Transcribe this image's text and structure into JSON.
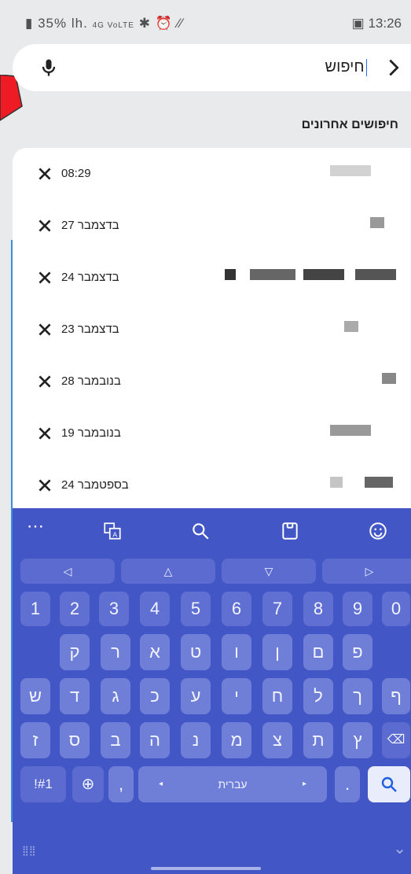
{
  "status": {
    "battery": "35%",
    "signal": "lh.",
    "network": "4G VoLTE",
    "time": "13:26"
  },
  "search": {
    "query": "חיפוש"
  },
  "recent": {
    "title": "חיפושים אחרונים",
    "items": [
      {
        "date": "08:29"
      },
      {
        "date": "27 בדצמבר"
      },
      {
        "date": "24 בדצמבר"
      },
      {
        "date": "23 בדצמבר"
      },
      {
        "date": "28 בנובמבר"
      },
      {
        "date": "19 בנובמבר"
      },
      {
        "date": "24 בספטמבר"
      }
    ]
  },
  "keyboard": {
    "number_row": [
      "1",
      "2",
      "3",
      "4",
      "5",
      "6",
      "7",
      "8",
      "9",
      "0"
    ],
    "row1": [
      "ק",
      "ר",
      "א",
      "ט",
      "ו",
      "ן",
      "ם",
      "פ"
    ],
    "row2": [
      "ש",
      "ד",
      "ג",
      "כ",
      "ע",
      "י",
      "ח",
      "ל",
      "ך",
      "ף"
    ],
    "row3": [
      "ז",
      "ס",
      "ב",
      "ה",
      "נ",
      "מ",
      "צ",
      "ת",
      "ץ"
    ],
    "symbols_key": "!#1",
    "comma_key": ",",
    "space_label": "עברית",
    "period_key": "."
  }
}
